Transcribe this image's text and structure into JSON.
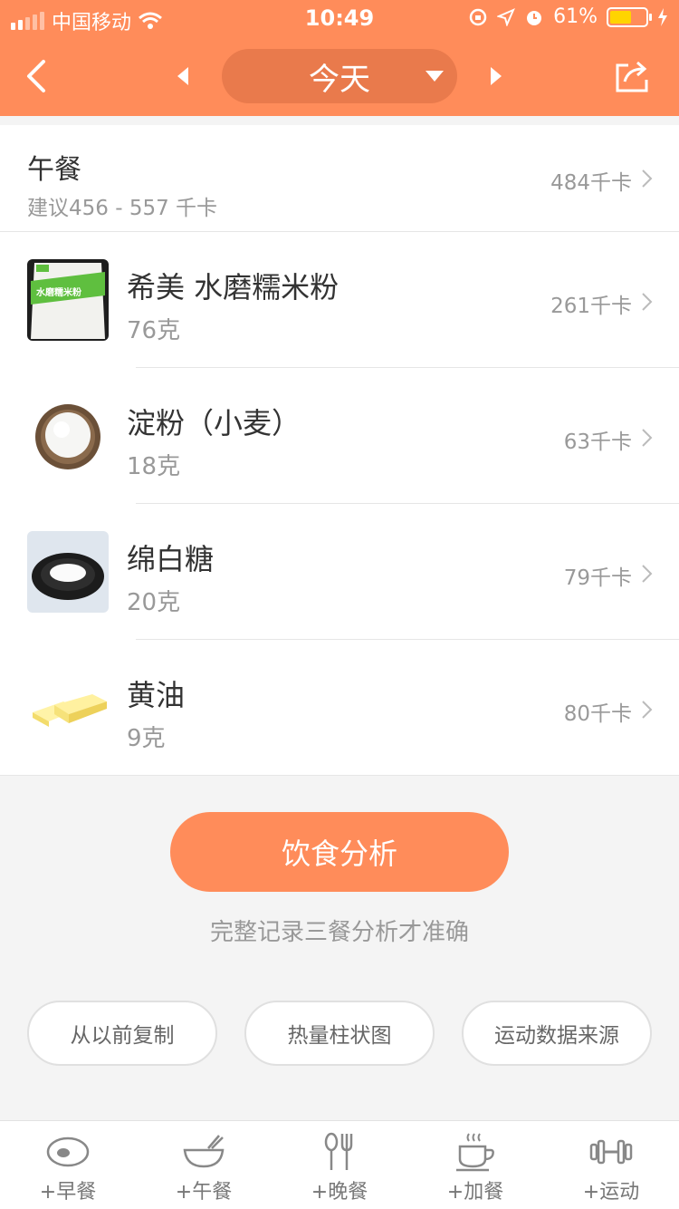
{
  "status": {
    "carrier": "中国移动",
    "time": "10:49",
    "battery": "61%",
    "battery_level": 0.61
  },
  "nav": {
    "date_label": "今天"
  },
  "meal": {
    "title": "午餐",
    "suggestion": "建议456 - 557 千卡",
    "total_kcal": "484千卡"
  },
  "items": [
    {
      "name": "希美 水磨糯米粉",
      "qty": "76克",
      "kcal": "261千卡",
      "icon": "rice-flour-bag-icon"
    },
    {
      "name": "淀粉（小麦）",
      "qty": "18克",
      "kcal": "63千卡",
      "icon": "starch-bowl-icon"
    },
    {
      "name": "绵白糖",
      "qty": "20克",
      "kcal": "79千卡",
      "icon": "sugar-plate-icon"
    },
    {
      "name": "黄油",
      "qty": "9克",
      "kcal": "80千卡",
      "icon": "butter-icon"
    }
  ],
  "analysis": {
    "button": "饮食分析",
    "hint": "完整记录三餐分析才准确"
  },
  "actions": [
    "从以前复制",
    "热量柱状图",
    "运动数据来源"
  ],
  "tabs": [
    {
      "label": "+早餐",
      "icon": "egg-icon"
    },
    {
      "label": "+午餐",
      "icon": "bowl-icon"
    },
    {
      "label": "+晚餐",
      "icon": "spoon-fork-icon"
    },
    {
      "label": "+加餐",
      "icon": "coffee-cup-icon"
    },
    {
      "label": "+运动",
      "icon": "dumbbell-icon"
    }
  ],
  "colors": {
    "accent": "#ff8c5a",
    "pill": "#e97a4c",
    "battery": "#ffd400"
  }
}
